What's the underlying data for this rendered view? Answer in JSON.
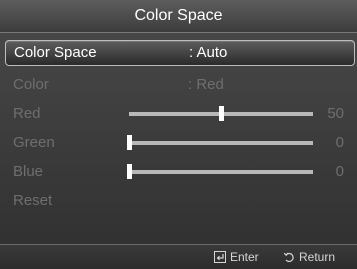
{
  "title": "Color Space",
  "menu": {
    "color_space": {
      "label": "Color Space",
      "value": ": Auto"
    },
    "color": {
      "label": "Color",
      "value": ": Red"
    },
    "red": {
      "label": "Red",
      "value": "50",
      "level": 0.5
    },
    "green": {
      "label": "Green",
      "value": "0",
      "level": 0.0
    },
    "blue": {
      "label": "Blue",
      "value": "0",
      "level": 0.0
    },
    "reset": {
      "label": "Reset"
    }
  },
  "footer": {
    "enter": "Enter",
    "return": "Return",
    "enter_icon": "enter-icon",
    "return_icon": "return-icon"
  },
  "colors": {
    "selected_text": "#ffffff",
    "disabled_text": "#6e6e6e",
    "slider_track": "#b8b8b8",
    "knob": "#ffffff"
  }
}
